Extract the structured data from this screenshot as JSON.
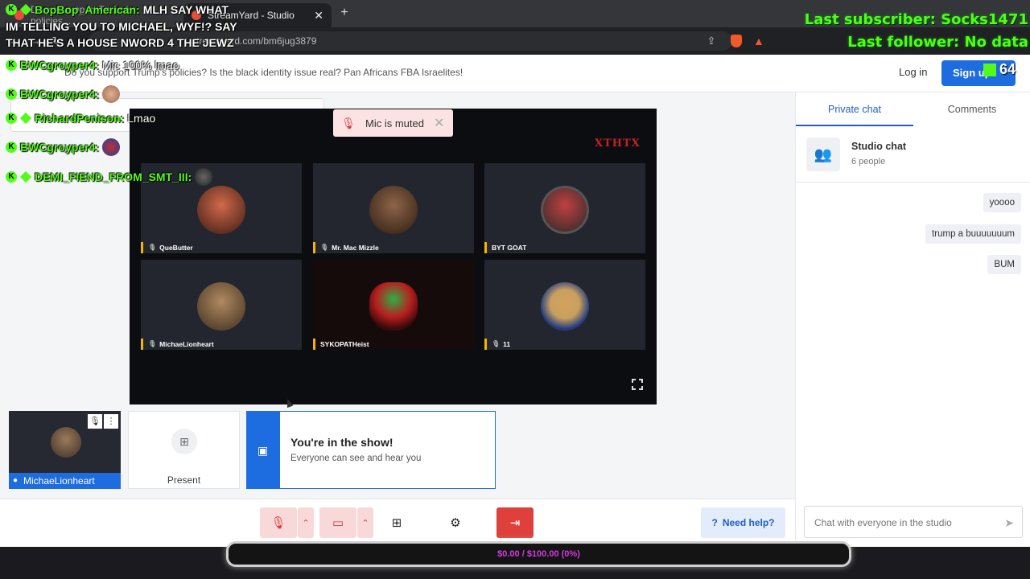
{
  "browser": {
    "tabs": [
      {
        "title": "Do you support Trump's policies...",
        "active": false
      },
      {
        "title": "StreamYard - Studio",
        "active": true
      }
    ],
    "new_tab_icon": "plus-icon",
    "url": "streamyard.com/bm6jug3879"
  },
  "studio": {
    "title": "Do you support Trump's policies? Is the black identity issue real? Pan Africans FBA Israelites!",
    "login_label": "Log in",
    "signup_label": "Sign up"
  },
  "stage": {
    "logo_text": "XTHTX",
    "participants": [
      {
        "name": "QueButter",
        "avatar_color": "#b33b2b"
      },
      {
        "name": "Mr. Mac Mizzle",
        "avatar_color": "#6a4a35"
      },
      {
        "name": "BYT GOAT",
        "avatar_color": "#8a1f1f"
      },
      {
        "name": "MichaeLionheart",
        "avatar_color": "#8a6a4a"
      },
      {
        "name": "SYKOPATHeist",
        "avatar_color": "#1e8a32"
      },
      {
        "name": "11",
        "avatar_color": "#c8a060"
      }
    ]
  },
  "toast": {
    "label": "Mic is muted"
  },
  "bottom_tiles": {
    "self_name": "MichaeLionheart",
    "present_label": "Present",
    "show_title": "You're in the show!",
    "show_subtitle": "Everyone can see and hear you"
  },
  "controls": {
    "help_label": "Need help?"
  },
  "chat": {
    "tabs": [
      "Private chat",
      "Comments"
    ],
    "header_title": "Studio chat",
    "header_people": "6 people",
    "messages": [
      "yoooo",
      "trump a buuuuuuum",
      "BUM"
    ],
    "input_placeholder": "Chat with everyone in the studio"
  },
  "overlay": {
    "chat_lines": [
      {
        "user": "BopBop_American:",
        "message": "MLH SAY WHAT"
      },
      {
        "user": "BWCgroyper4:",
        "message": "Mic 100% lmao"
      },
      {
        "user": "BWCgroyper4:",
        "message": ""
      },
      {
        "user": "RichardPenison:",
        "message": "Lmao"
      },
      {
        "user": "BWCgroyper4:",
        "message": ""
      },
      {
        "user": "DEMI_FIEND_FROM_SMT_III:",
        "message": ""
      }
    ],
    "continuation_lines": [
      "IM TELLING YOU TO MICHAEL, WYF!? SAY",
      "THAT HE'S A HOUSE NWORD 4 THE JEWZ"
    ],
    "last_subscriber": "Last subscriber: Socks1471",
    "last_follower": "Last follower: No data",
    "viewer_count": "64",
    "goal_text": "$0.00 / $100.00 (0%)",
    "goal_progress": 0,
    "accent_color": "#53fc18"
  }
}
